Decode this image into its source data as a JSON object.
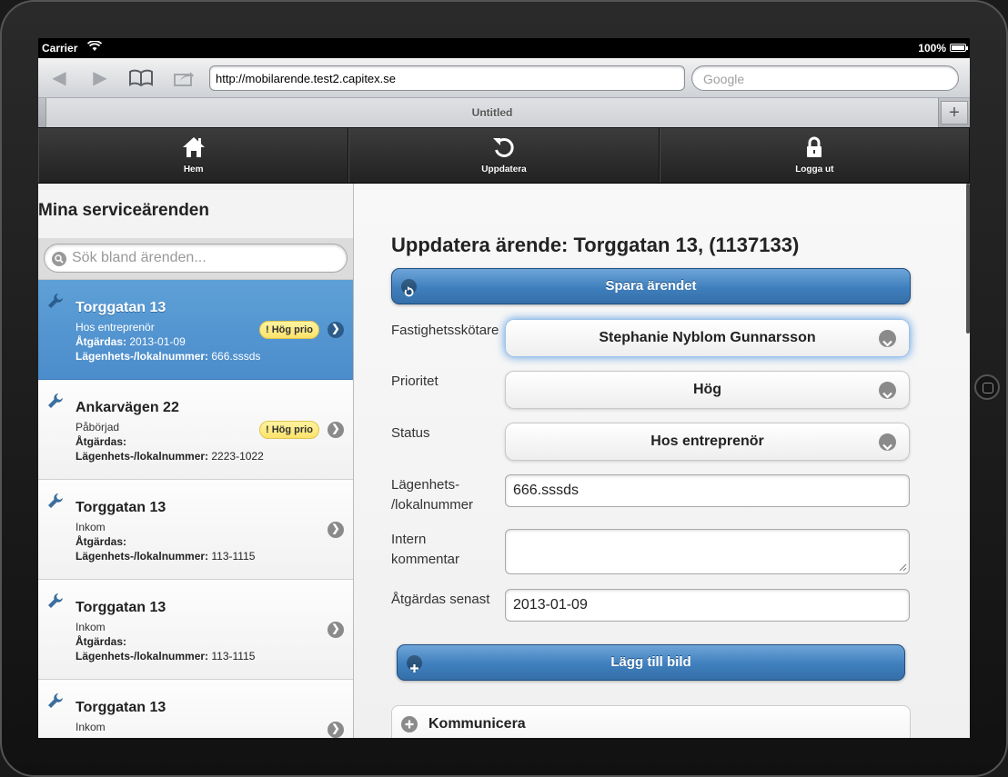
{
  "statusbar": {
    "carrier": "Carrier",
    "battery": "100%"
  },
  "browser": {
    "url": "http://mobilarende.test2.capitex.se",
    "search_placeholder": "Google",
    "tab_title": "Untitled",
    "new_tab": "+"
  },
  "appnav": {
    "home": "Hem",
    "refresh": "Uppdatera",
    "logout": "Logga ut"
  },
  "sidebar": {
    "heading": "Mina serviceärenden",
    "search_placeholder": "Sök bland ärenden...",
    "label_atgardas": "Åtgärdas:",
    "label_lgh": "Lägenhets-/lokalnummer:",
    "cases": [
      {
        "title": "Torggatan 13",
        "status": "Hos entreprenör",
        "atgardas": "2013-01-09",
        "lgh": "666.sssds",
        "badge": "! Hög prio"
      },
      {
        "title": "Ankarvägen 22",
        "status": "Påbörjad",
        "atgardas": "",
        "lgh": "2223-1022",
        "badge": "! Hög prio"
      },
      {
        "title": "Torggatan 13",
        "status": "Inkom",
        "atgardas": "",
        "lgh": "113-1115",
        "badge": ""
      },
      {
        "title": "Torggatan 13",
        "status": "Inkom",
        "atgardas": "",
        "lgh": "113-1115",
        "badge": ""
      },
      {
        "title": "Torggatan 13",
        "status": "Inkom",
        "atgardas": "",
        "lgh": "",
        "badge": ""
      }
    ]
  },
  "form": {
    "title": "Uppdatera ärende: Torggatan 13, (1137133)",
    "save_label": "Spara ärendet",
    "fastighetsskotare_label": "Fastighetsskötare",
    "fastighetsskotare_value": "Stephanie Nyblom Gunnarsson",
    "prioritet_label": "Prioritet",
    "prioritet_value": "Hög",
    "status_label": "Status",
    "status_value": "Hos entreprenör",
    "lgh_label_1": "Lägenhets-",
    "lgh_label_2": "/lokalnummer",
    "lgh_value": "666.sssds",
    "kommentar_label_1": "Intern",
    "kommentar_label_2": "kommentar",
    "kommentar_value": "",
    "senast_label": "Åtgärdas senast",
    "senast_value": "2013-01-09",
    "add_image_label": "Lägg till bild",
    "communicate_label": "Kommunicera"
  },
  "colors": {
    "accent": "#4b8ccc",
    "badge": "#fde36a",
    "navbar": "#2b2b2b"
  }
}
